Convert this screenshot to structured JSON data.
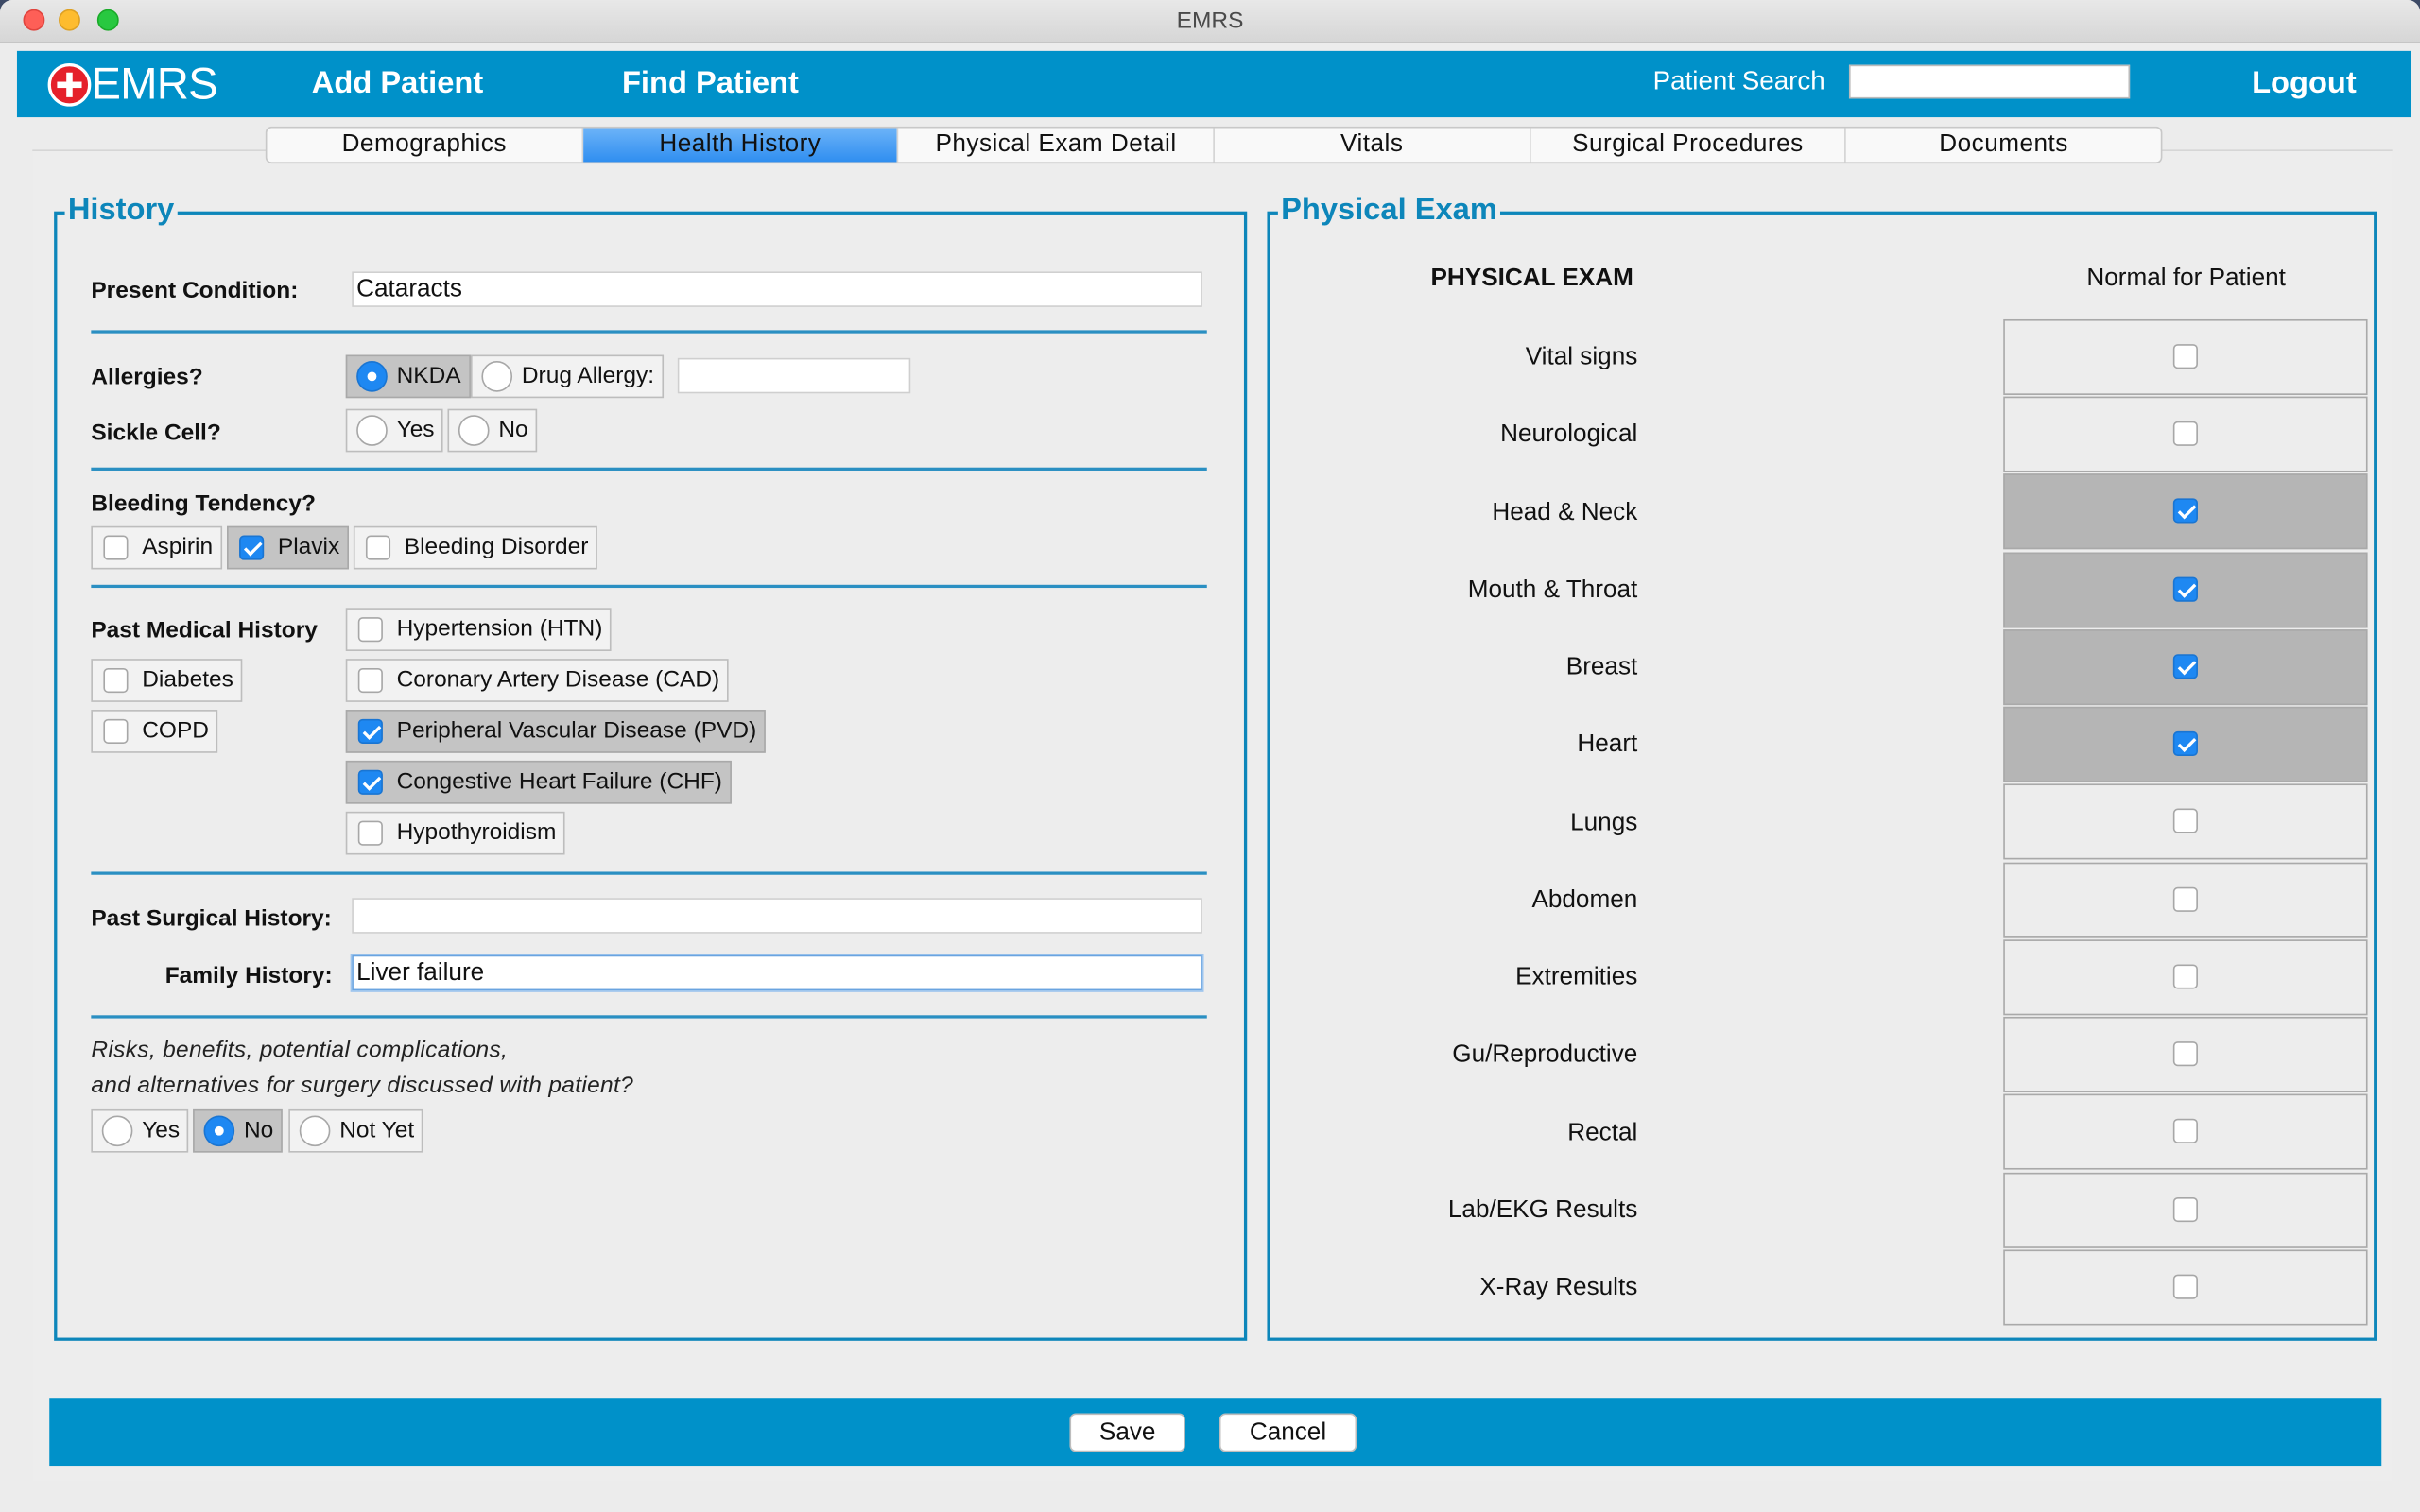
{
  "window": {
    "title": "EMRS"
  },
  "app": {
    "logo_text": "EMRS",
    "nav": {
      "add_patient": "Add Patient",
      "find_patient": "Find Patient",
      "logout": "Logout"
    },
    "patient_search": {
      "label": "Patient Search",
      "value": ""
    }
  },
  "tabs": [
    {
      "label": "Demographics",
      "active": false
    },
    {
      "label": "Health History",
      "active": true
    },
    {
      "label": "Physical Exam Detail",
      "active": false
    },
    {
      "label": "Vitals",
      "active": false
    },
    {
      "label": "Surgical Procedures",
      "active": false
    },
    {
      "label": "Documents",
      "active": false
    }
  ],
  "history": {
    "title": "History",
    "present_condition": {
      "label": "Present Condition:",
      "value": "Cataracts"
    },
    "allergies": {
      "label": "Allergies?",
      "nkda": {
        "label": "NKDA",
        "selected": true
      },
      "drug_allergy": {
        "label": "Drug Allergy:",
        "selected": false,
        "value": ""
      }
    },
    "sickle_cell": {
      "label": "Sickle Cell?",
      "yes": "Yes",
      "no": "No"
    },
    "bleeding": {
      "label": "Bleeding Tendency?",
      "aspirin": {
        "label": "Aspirin",
        "checked": false
      },
      "plavix": {
        "label": "Plavix",
        "checked": true
      },
      "disorder": {
        "label": "Bleeding Disorder",
        "checked": false
      }
    },
    "pmh": {
      "label": "Past Medical History",
      "diabetes": {
        "label": "Diabetes",
        "checked": false
      },
      "copd": {
        "label": "COPD",
        "checked": false
      },
      "htn": {
        "label": "Hypertension (HTN)",
        "checked": false
      },
      "cad": {
        "label": "Coronary Artery Disease (CAD)",
        "checked": false
      },
      "pvd": {
        "label": "Peripheral Vascular Disease (PVD)",
        "checked": true
      },
      "chf": {
        "label": "Congestive Heart Failure (CHF)",
        "checked": true
      },
      "hypothyroidism": {
        "label": "Hypothyroidism",
        "checked": false
      }
    },
    "past_surgical": {
      "label": "Past Surgical History:",
      "value": ""
    },
    "family_history": {
      "label": "Family History:",
      "value": "Liver failure"
    },
    "risks": {
      "line1": "Risks, benefits, potential complications,",
      "line2": "and alternatives for surgery discussed with patient?",
      "yes": "Yes",
      "no": "No",
      "not_yet": "Not Yet",
      "selected": "No"
    }
  },
  "physical_exam": {
    "title": "Physical Exam",
    "header_left": "PHYSICAL EXAM",
    "header_right": "Normal for Patient",
    "rows": [
      {
        "label": "Vital signs",
        "checked": false
      },
      {
        "label": "Neurological",
        "checked": false
      },
      {
        "label": "Head & Neck",
        "checked": true
      },
      {
        "label": "Mouth & Throat",
        "checked": true
      },
      {
        "label": "Breast",
        "checked": true
      },
      {
        "label": "Heart",
        "checked": true
      },
      {
        "label": "Lungs",
        "checked": false
      },
      {
        "label": "Abdomen",
        "checked": false
      },
      {
        "label": "Extremities",
        "checked": false
      },
      {
        "label": "Gu/Reproductive",
        "checked": false
      },
      {
        "label": "Rectal",
        "checked": false
      },
      {
        "label": "Lab/EKG Results",
        "checked": false
      },
      {
        "label": "X-Ray Results",
        "checked": false
      }
    ]
  },
  "footer": {
    "save": "Save",
    "cancel": "Cancel"
  },
  "colors": {
    "brand": "#0091c9",
    "group_border": "#0d86ba",
    "check_accent": "#1e88f2"
  }
}
